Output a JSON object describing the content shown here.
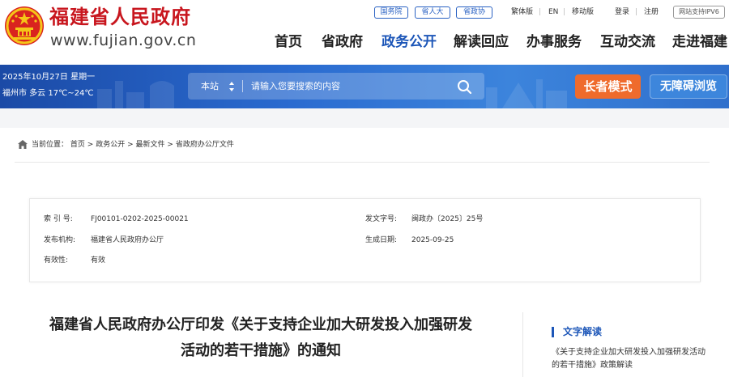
{
  "header": {
    "site_name": "福建省人民政府",
    "site_url": "www.fujian.gov.cn",
    "gov_links": [
      "国务院",
      "省人大",
      "省政协"
    ],
    "utility_links": [
      "繁体版",
      "EN",
      "移动版",
      "登录",
      "注册"
    ],
    "ipv6_badge": "网站支持IPV6"
  },
  "nav": {
    "items": [
      "首页",
      "省政府",
      "政务公开",
      "解读回应",
      "办事服务",
      "互动交流",
      "走进福建"
    ],
    "active": "政务公开"
  },
  "banner": {
    "date": "2025年10月27日 星期一",
    "weather": "福州市 多云 17℃~24℃",
    "search_scope": "本站",
    "search_placeholder": "请输入您要搜索的内容",
    "elder_mode": "长者模式",
    "accessible_browse": "无障碍浏览"
  },
  "breadcrumb": {
    "prefix": "当前位置：",
    "items": [
      "首页",
      "政务公开",
      "最新文件",
      "省政府办公厅文件"
    ],
    "separator": ">"
  },
  "meta": {
    "index_label": "索 引 号:",
    "index_value": "FJ00101-0202-2025-00021",
    "doc_no_label": "发文字号:",
    "doc_no_value": "闽政办〔2025〕25号",
    "issuer_label": "发布机构:",
    "issuer_value": "福建省人民政府办公厅",
    "date_label": "生成日期:",
    "date_value": "2025-09-25",
    "validity_label": "有效性:",
    "validity_value": "有效"
  },
  "document": {
    "title_line1": "福建省人民政府办公厅印发《关于支持企业加大研发投入加强研发",
    "title_line2": "活动的若干措施》的通知"
  },
  "sidebar": {
    "section_title": "文字解读",
    "link": "《关于支持企业加大研发投入加强研发活动的若干措施》政策解读"
  },
  "colors": {
    "brand_red": "#c8161e",
    "accent_blue": "#1c56b8",
    "elder_orange": "#ef6b2c"
  }
}
